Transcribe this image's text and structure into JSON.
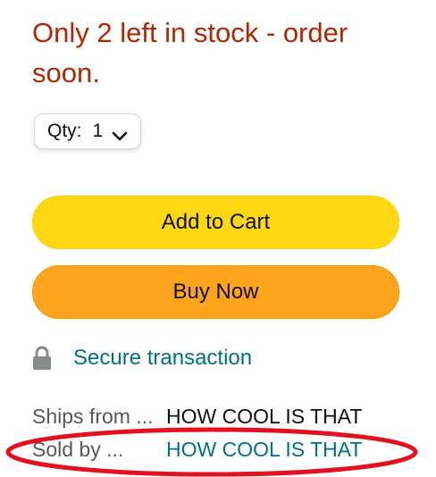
{
  "stock": {
    "message": "Only 2 left in stock - order soon."
  },
  "quantity": {
    "label": "Qty:",
    "value": "1"
  },
  "buttons": {
    "add_to_cart": "Add to Cart",
    "buy_now": "Buy Now"
  },
  "secure": {
    "icon": "lock-icon",
    "label": "Secure transaction"
  },
  "ships_from": {
    "label": "Ships from ...",
    "value": "HOW COOL IS THAT"
  },
  "sold_by": {
    "label": "Sold by ...",
    "value": "HOW COOL IS THAT"
  },
  "colors": {
    "stock_text": "#b12704",
    "add_to_cart_bg": "#ffd814",
    "buy_now_bg": "#ffa41c",
    "link": "#007185",
    "annotation": "#e3111d"
  }
}
